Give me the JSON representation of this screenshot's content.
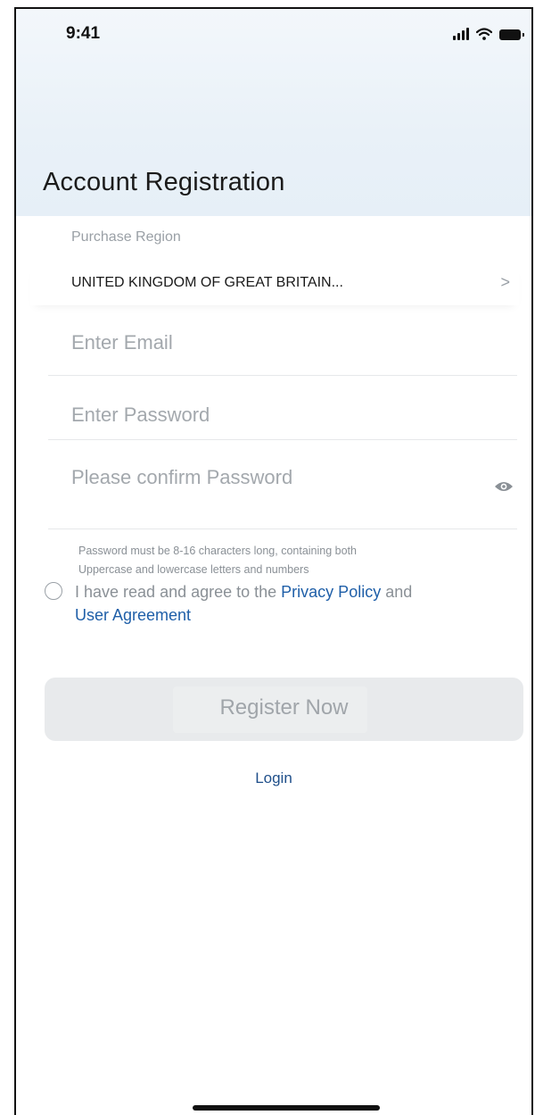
{
  "status_bar": {
    "time": "9:41"
  },
  "page": {
    "title": "Account Registration"
  },
  "region": {
    "label": "Purchase Region",
    "value": "UNITED KINGDOM OF GREAT BRITAIN...",
    "chevron": ">"
  },
  "form": {
    "email_placeholder": "Enter Email",
    "password_placeholder": "Enter Password",
    "confirm_placeholder": "Please confirm Password",
    "hint_line1": "Password must be 8-16 characters long, containing both",
    "hint_line2": "Uppercase and lowercase letters and numbers"
  },
  "agreement": {
    "prefix": "I have read and agree to the ",
    "privacy_link": "Privacy Policy",
    "conjunction": " and",
    "user_link": "User Agreement"
  },
  "actions": {
    "register_label": "Register Now",
    "login_label": "Login"
  },
  "icons": {
    "signal": "signal-icon",
    "wifi": "wifi-icon",
    "battery": "battery-icon",
    "eye": "eye-icon",
    "chevron": "chevron-right-icon"
  },
  "colors": {
    "link": "#1f5fa8",
    "placeholder": "#a3a8ad",
    "button_bg": "#e8eaec"
  }
}
